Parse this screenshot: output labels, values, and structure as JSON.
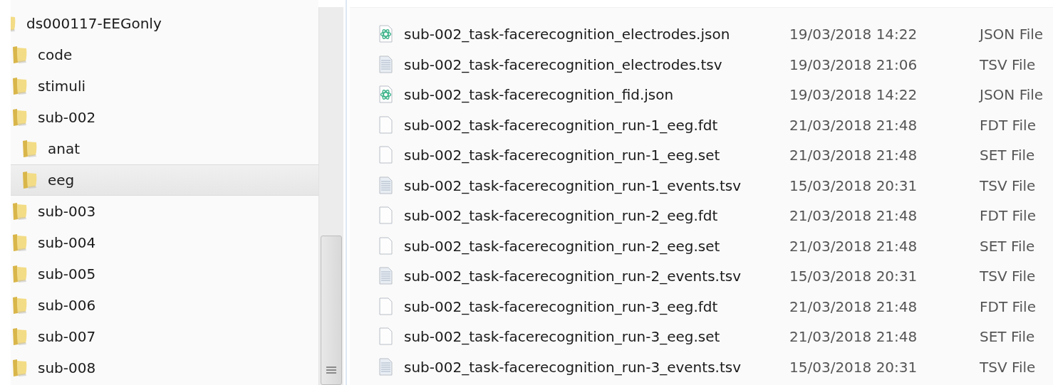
{
  "navigation_tree": {
    "items": [
      {
        "label": "ds000117-EEGonly",
        "selected": false,
        "children": [
          {
            "label": "code",
            "selected": false
          },
          {
            "label": "stimuli",
            "selected": false
          },
          {
            "label": "sub-002",
            "selected": false,
            "children": [
              {
                "label": "anat",
                "selected": false
              },
              {
                "label": "eeg",
                "selected": true
              }
            ]
          },
          {
            "label": "sub-003",
            "selected": false
          },
          {
            "label": "sub-004",
            "selected": false
          },
          {
            "label": "sub-005",
            "selected": false
          },
          {
            "label": "sub-006",
            "selected": false
          },
          {
            "label": "sub-007",
            "selected": false
          },
          {
            "label": "sub-008",
            "selected": false
          }
        ]
      }
    ]
  },
  "file_list": {
    "rows": [
      {
        "kind": "json",
        "name": "sub-002_task-facerecognition_electrodes.json",
        "date_modified": "19/03/2018 14:22",
        "type": "JSON File"
      },
      {
        "kind": "text",
        "name": "sub-002_task-facerecognition_electrodes.tsv",
        "date_modified": "19/03/2018 21:06",
        "type": "TSV File"
      },
      {
        "kind": "json",
        "name": "sub-002_task-facerecognition_fid.json",
        "date_modified": "19/03/2018 14:22",
        "type": "JSON File"
      },
      {
        "kind": "blank",
        "name": "sub-002_task-facerecognition_run-1_eeg.fdt",
        "date_modified": "21/03/2018 21:48",
        "type": "FDT File"
      },
      {
        "kind": "blank",
        "name": "sub-002_task-facerecognition_run-1_eeg.set",
        "date_modified": "21/03/2018 21:48",
        "type": "SET File"
      },
      {
        "kind": "text",
        "name": "sub-002_task-facerecognition_run-1_events.tsv",
        "date_modified": "15/03/2018 20:31",
        "type": "TSV File"
      },
      {
        "kind": "blank",
        "name": "sub-002_task-facerecognition_run-2_eeg.fdt",
        "date_modified": "21/03/2018 21:48",
        "type": "FDT File"
      },
      {
        "kind": "blank",
        "name": "sub-002_task-facerecognition_run-2_eeg.set",
        "date_modified": "21/03/2018 21:48",
        "type": "SET File"
      },
      {
        "kind": "text",
        "name": "sub-002_task-facerecognition_run-2_events.tsv",
        "date_modified": "15/03/2018 20:31",
        "type": "TSV File"
      },
      {
        "kind": "blank",
        "name": "sub-002_task-facerecognition_run-3_eeg.fdt",
        "date_modified": "21/03/2018 21:48",
        "type": "FDT File"
      },
      {
        "kind": "blank",
        "name": "sub-002_task-facerecognition_run-3_eeg.set",
        "date_modified": "21/03/2018 21:48",
        "type": "SET File"
      },
      {
        "kind": "text",
        "name": "sub-002_task-facerecognition_run-3_events.tsv",
        "date_modified": "15/03/2018 20:31",
        "type": "TSV File"
      }
    ]
  }
}
